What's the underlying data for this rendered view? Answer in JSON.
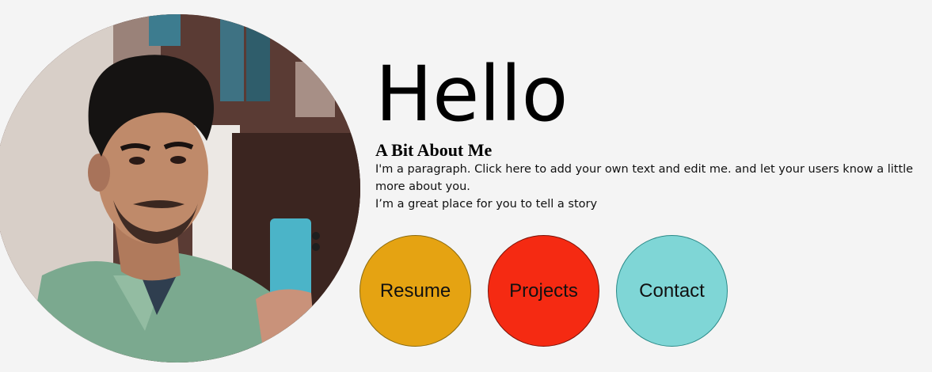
{
  "profile": {
    "photo_icon": "portrait-photo"
  },
  "hero": {
    "title": "Hello",
    "about_heading": "A Bit About Me",
    "about_line1": "I'm a paragraph. Click here to add your own text and edit me. and let your users know a little more about you.",
    "about_line2": "I’m a great place for you to tell a story"
  },
  "buttons": {
    "resume": {
      "label": "Resume",
      "color": "#e5a312"
    },
    "projects": {
      "label": "Projects",
      "color": "#f52a12"
    },
    "contact": {
      "label": "Contact",
      "color": "#7fd6d6"
    }
  },
  "colors": {
    "background": "#f4f4f4",
    "text": "#000000"
  }
}
